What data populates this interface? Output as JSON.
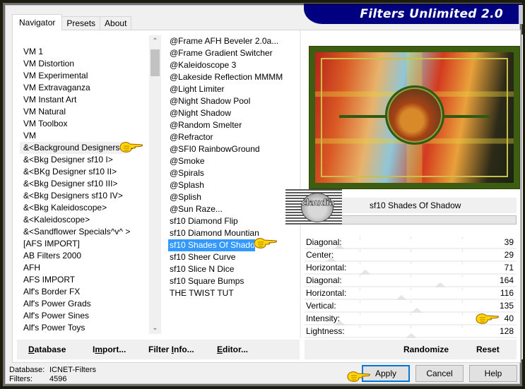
{
  "title": "Filters Unlimited 2.0",
  "tabs": [
    {
      "label": "Navigator",
      "active": true
    },
    {
      "label": "Presets",
      "active": false
    },
    {
      "label": "About",
      "active": false
    }
  ],
  "categories": {
    "selected": "&<Background Designers IV>",
    "items": [
      "VM 1",
      "VM Distortion",
      "VM Experimental",
      "VM Extravaganza",
      "VM Instant Art",
      "VM Natural",
      "VM Toolbox",
      "VM",
      "&<Background Designers IV>",
      "&<Bkg Designer sf10 I>",
      "&<BKg Designer sf10 II>",
      "&<Bkg Designer sf10 III>",
      "&<Bkg Designers sf10 IV>",
      "&<Bkg Kaleidoscope>",
      "&<Kaleidoscope>",
      "&<Sandflower Specials^v^ >",
      "[AFS IMPORT]",
      "AB Filters 2000",
      "AFH",
      "AFS IMPORT",
      "Alf's Border FX",
      "Alf's Power Grads",
      "Alf's Power Sines",
      "Alf's Power Toys"
    ]
  },
  "filters": {
    "selected": "sf10 Shades Of Shadow",
    "items": [
      "@Frame AFH Beveler 2.0a...",
      "@Frame Gradient Switcher",
      "@Kaleidoscope 3",
      "@Lakeside Reflection MMMM",
      "@Light Limiter",
      "@Night Shadow Pool",
      "@Night Shadow",
      "@Random Smelter",
      "@Refractor",
      "@SFI0 RainbowGround",
      "@Smoke",
      "@Spirals",
      "@Splash",
      "@Splish",
      "@Sun Raze...",
      "sf10 Diamond Flip",
      "sf10 Diamond Mountian",
      "sf10 Shades Of Shadow",
      "sf10 Sheer Curve",
      "sf10 Slice N Dice",
      "sf10 Square Bumps",
      "THE TWIST TUT"
    ]
  },
  "filter_name": "sf10 Shades Of Shadow",
  "watermark": "claudia",
  "parameters": [
    {
      "label": "Diagonal:",
      "value": "39"
    },
    {
      "label": "Center:",
      "value": "29"
    },
    {
      "label": "Horizontal:",
      "value": "71"
    },
    {
      "label": "Diagonal:",
      "value": "164"
    },
    {
      "label": "Horizontal:",
      "value": "116"
    },
    {
      "label": "Vertical:",
      "value": "135"
    },
    {
      "label": "Intensity:",
      "value": "40"
    },
    {
      "label": "Lightness:",
      "value": "128"
    }
  ],
  "left_buttons": {
    "database": {
      "pre": "",
      "ul": "D",
      "post": "atabase"
    },
    "import": {
      "pre": "I",
      "ul": "m",
      "post": "port..."
    },
    "filter_info": {
      "pre": "Filter ",
      "ul": "I",
      "post": "nfo..."
    },
    "editor": {
      "pre": "",
      "ul": "E",
      "post": "ditor..."
    }
  },
  "right_buttons": {
    "randomize": "Randomize",
    "reset": "Reset"
  },
  "status": {
    "database_label": "Database:",
    "database_value": "ICNET-Filters",
    "filters_label": "Filters:",
    "filters_value": "4596"
  },
  "dialog_buttons": {
    "apply": "Apply",
    "cancel": "Cancel",
    "help": "Help"
  },
  "colors": {
    "banner": "#000080",
    "selection": "#3399ff",
    "default_button_border": "#0078d7",
    "outer_frame": "#1b1c0c"
  },
  "icons": {
    "pointer_hand": "pointing-hand-icon",
    "scroll_up": "chevron-up-icon",
    "scroll_down": "chevron-down-icon"
  }
}
